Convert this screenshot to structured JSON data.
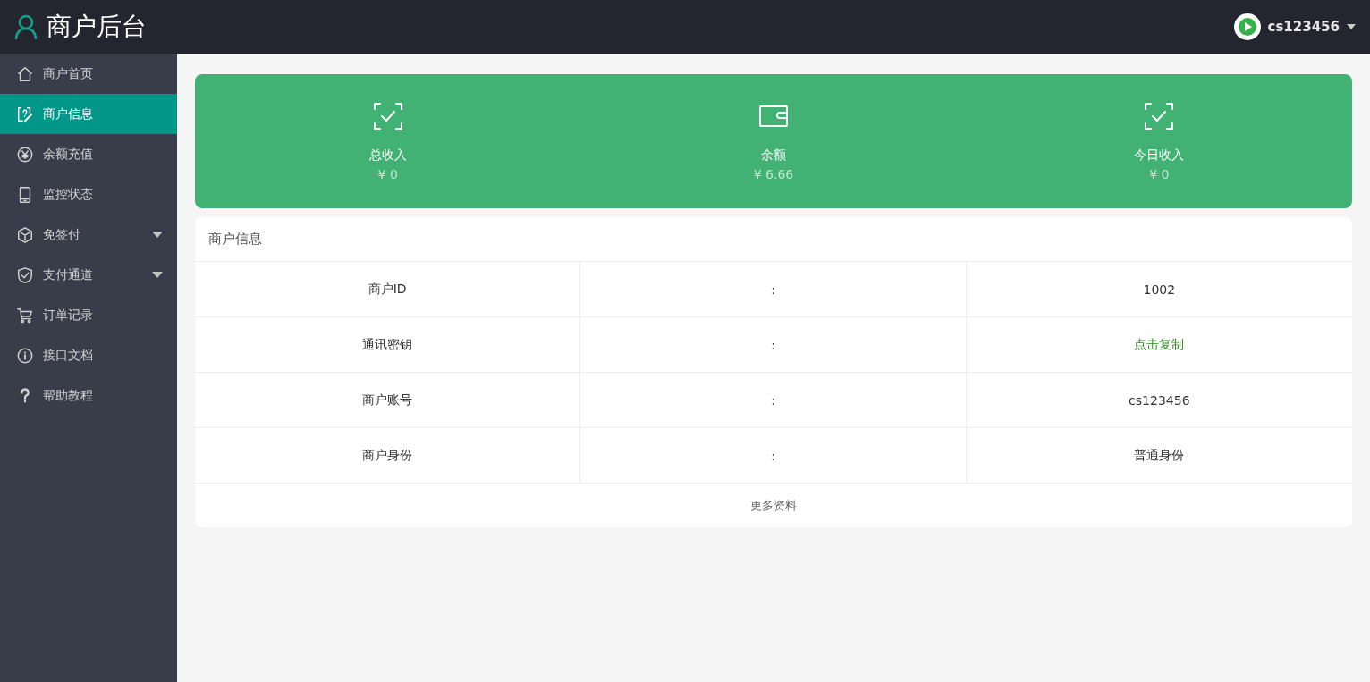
{
  "header": {
    "title": "商户后台",
    "user": "cs123456"
  },
  "sidebar": {
    "items": [
      {
        "label": "商户首页",
        "selected": false,
        "kind": "link"
      },
      {
        "label": "商户信息",
        "selected": true,
        "kind": "link"
      },
      {
        "label": "余额充值",
        "selected": false,
        "kind": "link"
      },
      {
        "label": "监控状态",
        "selected": false,
        "kind": "link"
      },
      {
        "label": "免签付",
        "selected": false,
        "kind": "group"
      },
      {
        "label": "支付通道",
        "selected": false,
        "kind": "group"
      },
      {
        "label": "订单记录",
        "selected": false,
        "kind": "link"
      },
      {
        "label": "接口文档",
        "selected": false,
        "kind": "link"
      },
      {
        "label": "帮助教程",
        "selected": false,
        "kind": "link"
      }
    ]
  },
  "stats": [
    {
      "label": "总收入",
      "value": "¥ 0"
    },
    {
      "label": "余额",
      "value": "¥ 6.66"
    },
    {
      "label": "今日收入",
      "value": "¥ 0"
    }
  ],
  "info_card": {
    "title": "商户信息",
    "rows": [
      {
        "label": "商户ID",
        "separator": ":",
        "value": "1002",
        "kind": "text"
      },
      {
        "label": "通讯密钥",
        "separator": ":",
        "value": "点击复制",
        "kind": "link"
      },
      {
        "label": "商户账号",
        "separator": ":",
        "value": "cs123456",
        "kind": "text"
      },
      {
        "label": "商户身份",
        "separator": ":",
        "value": "普通身份",
        "kind": "text"
      }
    ],
    "footer_link": "更多资料"
  }
}
